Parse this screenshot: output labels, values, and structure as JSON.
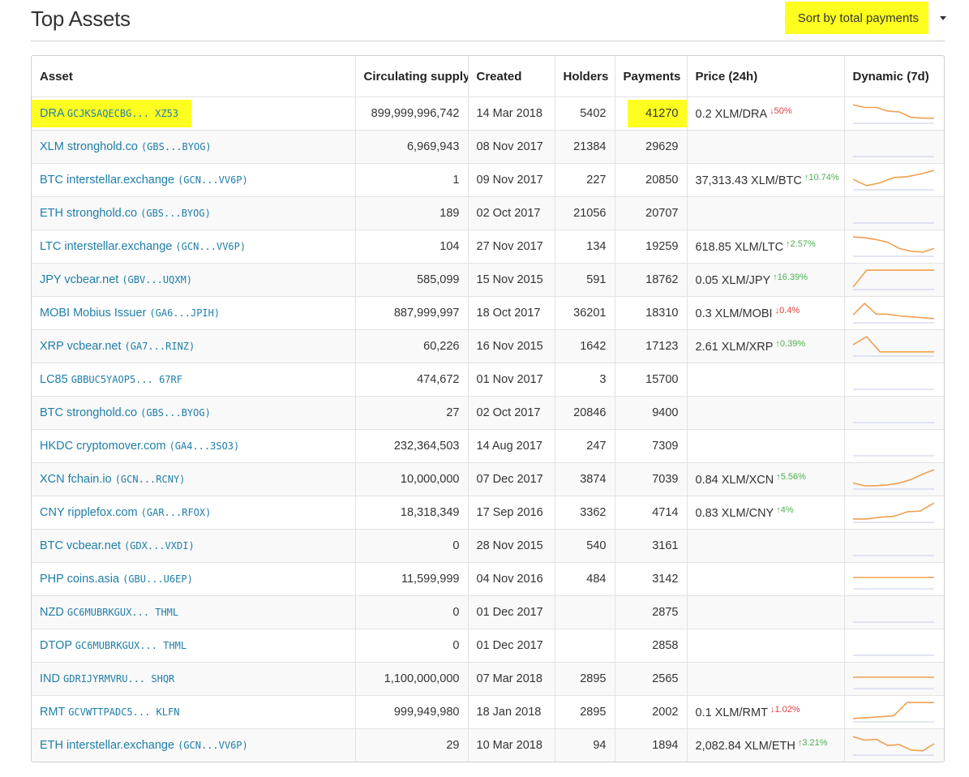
{
  "page": {
    "title": "Top Assets",
    "sort_label": "Sort by total payments"
  },
  "colors": {
    "highlight": "#ffff1f",
    "link": "#1f7ea8",
    "up": "#4caf50",
    "down": "#e04040",
    "spark": "#f0a050",
    "baseline": "#c5cbe8"
  },
  "table": {
    "headers": [
      "Asset",
      "Circulating supply",
      "Created",
      "Holders",
      "Payments",
      "Price (24h)",
      "Dynamic (7d)"
    ],
    "rows": [
      {
        "code": "DRA",
        "issuer_name": "",
        "issuer_key": "GCJKSAQECBG... XZ53",
        "supply": "899,999,996,742",
        "created": "14 Mar 2018",
        "holders": "5402",
        "payments": "41270",
        "price": "0.2 XLM/DRA",
        "change": "50%",
        "dir": "down",
        "spark": [
          0.9,
          0.75,
          0.75,
          0.55,
          0.5,
          0.2,
          0.15,
          0.15
        ],
        "highlight": true
      },
      {
        "code": "XLM",
        "issuer_name": "stronghold.co",
        "issuer_key": "(GBS...BYOG)",
        "supply": "6,969,943",
        "created": "08 Nov 2017",
        "holders": "21384",
        "payments": "29629",
        "price": "",
        "change": "",
        "dir": "",
        "spark": []
      },
      {
        "code": "BTC",
        "issuer_name": "interstellar.exchange",
        "issuer_key": "(GCN...VV6P)",
        "supply": "1",
        "created": "09 Nov 2017",
        "holders": "227",
        "payments": "20850",
        "price": "37,313.43 XLM/BTC",
        "change": "10.74%",
        "dir": "up",
        "spark": [
          0.45,
          0.1,
          0.25,
          0.55,
          0.6,
          0.75,
          0.95
        ]
      },
      {
        "code": "ETH",
        "issuer_name": "stronghold.co",
        "issuer_key": "(GBS...BYOG)",
        "supply": "189",
        "created": "02 Oct 2017",
        "holders": "21056",
        "payments": "20707",
        "price": "",
        "change": "",
        "dir": "",
        "spark": []
      },
      {
        "code": "LTC",
        "issuer_name": "interstellar.exchange",
        "issuer_key": "(GCN...VV6P)",
        "supply": "104",
        "created": "27 Nov 2017",
        "holders": "134",
        "payments": "19259",
        "price": "618.85 XLM/LTC",
        "change": "2.57%",
        "dir": "up",
        "spark": [
          0.95,
          0.9,
          0.8,
          0.65,
          0.3,
          0.15,
          0.1,
          0.3
        ]
      },
      {
        "code": "JPY",
        "issuer_name": "vcbear.net",
        "issuer_key": "(GBV...UQXM)",
        "supply": "585,099",
        "created": "15 Nov 2015",
        "holders": "591",
        "payments": "18762",
        "price": "0.05 XLM/JPY",
        "change": "16.39%",
        "dir": "up",
        "spark": [
          0.0,
          0.95,
          0.95,
          0.95,
          0.95,
          0.95,
          0.95
        ]
      },
      {
        "code": "MOBI",
        "issuer_name": "Mobius Issuer",
        "issuer_key": "(GA6...JPIH)",
        "supply": "887,999,997",
        "created": "18 Oct 2017",
        "holders": "36201",
        "payments": "18310",
        "price": "0.3 XLM/MOBI",
        "change": "0.4%",
        "dir": "down",
        "spark": [
          0.3,
          0.95,
          0.35,
          0.35,
          0.25,
          0.2,
          0.15,
          0.1
        ]
      },
      {
        "code": "XRP",
        "issuer_name": "vcbear.net",
        "issuer_key": "(GA7...RINZ)",
        "supply": "60,226",
        "created": "16 Nov 2015",
        "holders": "1642",
        "payments": "17123",
        "price": "2.61 XLM/XRP",
        "change": "0.39%",
        "dir": "up",
        "spark": [
          0.5,
          0.95,
          0.1,
          0.1,
          0.1,
          0.1,
          0.1
        ]
      },
      {
        "code": "LC85",
        "issuer_name": "",
        "issuer_key": "GBBUC5YAOP5... 67RF",
        "supply": "474,672",
        "created": "01 Nov 2017",
        "holders": "3",
        "payments": "15700",
        "price": "",
        "change": "",
        "dir": "",
        "spark": []
      },
      {
        "code": "BTC",
        "issuer_name": "stronghold.co",
        "issuer_key": "(GBS...BYOG)",
        "supply": "27",
        "created": "02 Oct 2017",
        "holders": "20846",
        "payments": "9400",
        "price": "",
        "change": "",
        "dir": "",
        "spark": []
      },
      {
        "code": "HKDC",
        "issuer_name": "cryptomover.com",
        "issuer_key": "(GA4...3SO3)",
        "supply": "232,364,503",
        "created": "14 Aug 2017",
        "holders": "247",
        "payments": "7309",
        "price": "",
        "change": "",
        "dir": "",
        "spark": []
      },
      {
        "code": "XCN",
        "issuer_name": "fchain.io",
        "issuer_key": "(GCN...RCNY)",
        "supply": "10,000,000",
        "created": "07 Dec 2017",
        "holders": "3874",
        "payments": "7039",
        "price": "0.84 XLM/XCN",
        "change": "5.56%",
        "dir": "up",
        "spark": [
          0.2,
          0.05,
          0.05,
          0.1,
          0.2,
          0.4,
          0.7,
          0.95
        ]
      },
      {
        "code": "CNY",
        "issuer_name": "ripplefox.com",
        "issuer_key": "(GAR...RFOX)",
        "supply": "18,318,349",
        "created": "17 Sep 2016",
        "holders": "3362",
        "payments": "4714",
        "price": "0.83 XLM/CNY",
        "change": "4%",
        "dir": "up",
        "spark": [
          0.05,
          0.05,
          0.15,
          0.2,
          0.45,
          0.5,
          0.95
        ]
      },
      {
        "code": "BTC",
        "issuer_name": "vcbear.net",
        "issuer_key": "(GDX...VXDI)",
        "supply": "0",
        "created": "28 Nov 2015",
        "holders": "540",
        "payments": "3161",
        "price": "",
        "change": "",
        "dir": "",
        "spark": []
      },
      {
        "code": "PHP",
        "issuer_name": "coins.asia",
        "issuer_key": "(GBU...U6EP)",
        "supply": "11,599,999",
        "created": "04 Nov 2016",
        "holders": "484",
        "payments": "3142",
        "price": "",
        "change": "",
        "dir": "",
        "spark": [
          0.5,
          0.5,
          0.5,
          0.5,
          0.5
        ]
      },
      {
        "code": "NZD",
        "issuer_name": "",
        "issuer_key": "GC6MUBRKGUX... THML",
        "supply": "0",
        "created": "01 Dec 2017",
        "holders": "",
        "payments": "2875",
        "price": "",
        "change": "",
        "dir": "",
        "spark": []
      },
      {
        "code": "DTOP",
        "issuer_name": "",
        "issuer_key": "GC6MUBRKGUX... THML",
        "supply": "0",
        "created": "01 Dec 2017",
        "holders": "",
        "payments": "2858",
        "price": "",
        "change": "",
        "dir": "",
        "spark": []
      },
      {
        "code": "IND",
        "issuer_name": "",
        "issuer_key": "GDRIJYRMVRU... SHQR",
        "supply": "1,100,000,000",
        "created": "07 Mar 2018",
        "holders": "2895",
        "payments": "2565",
        "price": "",
        "change": "",
        "dir": "",
        "spark": [
          0.5,
          0.5,
          0.5,
          0.5,
          0.5
        ]
      },
      {
        "code": "RMT",
        "issuer_name": "",
        "issuer_key": "GCVWTTPADC5... KLFN",
        "supply": "999,949,980",
        "created": "18 Jan 2018",
        "holders": "2895",
        "payments": "2002",
        "price": "0.1 XLM/RMT",
        "change": "1.02%",
        "dir": "down",
        "spark": [
          0.05,
          0.1,
          0.15,
          0.2,
          0.95,
          0.95,
          0.95
        ]
      },
      {
        "code": "ETH",
        "issuer_name": "interstellar.exchange",
        "issuer_key": "(GCN...VV6P)",
        "supply": "29",
        "created": "10 Mar 2018",
        "holders": "94",
        "payments": "1894",
        "price": "2,082.84 XLM/ETH",
        "change": "3.21%",
        "dir": "up",
        "spark": [
          0.9,
          0.7,
          0.75,
          0.4,
          0.45,
          0.15,
          0.1,
          0.5
        ]
      }
    ]
  }
}
